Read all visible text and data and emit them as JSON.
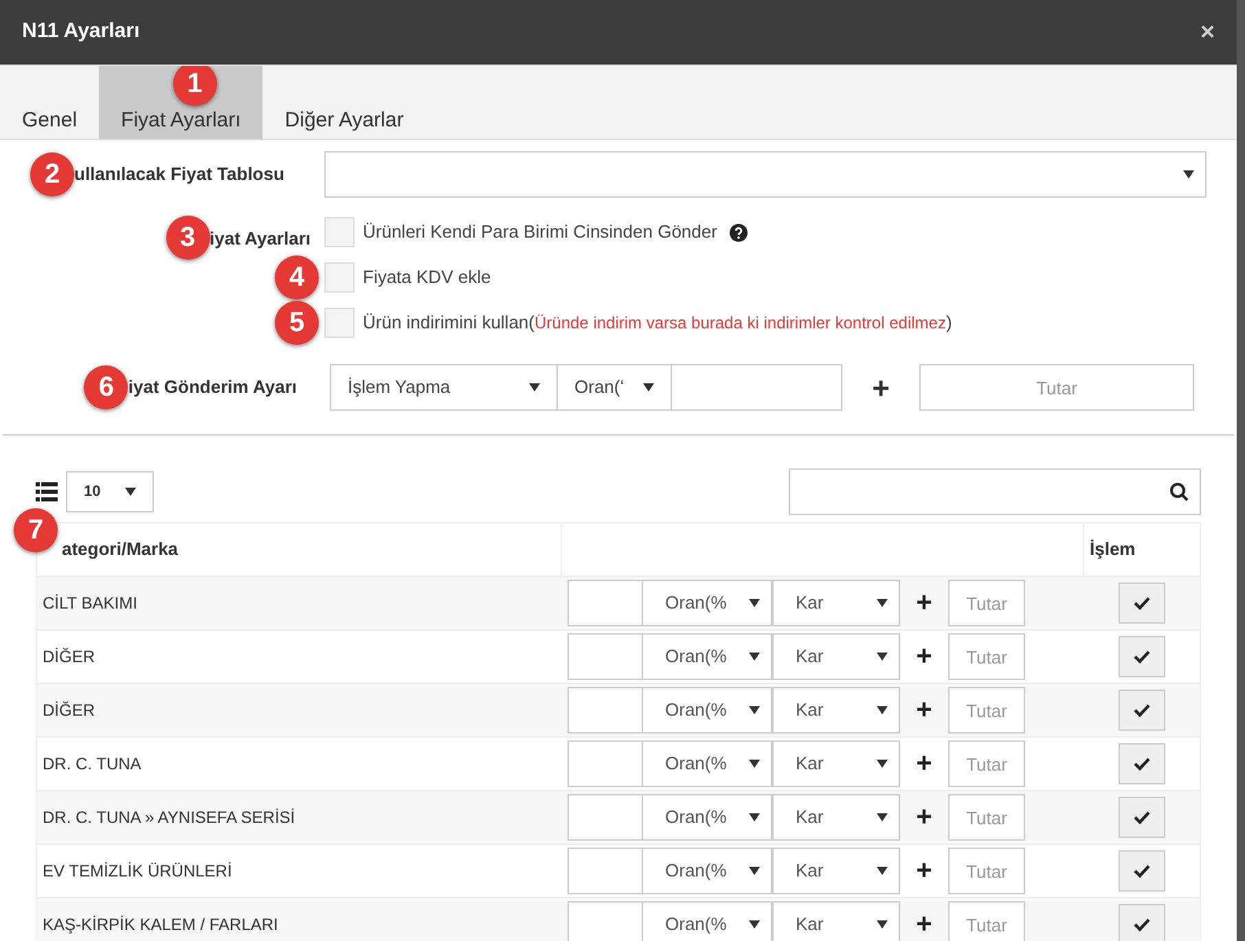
{
  "window": {
    "title": "N11 Ayarları",
    "close": "×"
  },
  "tabs": [
    {
      "label": "Genel",
      "selected": false
    },
    {
      "label": "Fiyat Ayarları",
      "selected": true,
      "badge": "1"
    },
    {
      "label": "Diğer Ayarlar",
      "selected": false
    }
  ],
  "price_table": {
    "badge": "2",
    "label": "ullanılacak Fiyat Tablosu"
  },
  "price_settings": {
    "badge": "3",
    "label": "iyat Ayarları",
    "options": [
      {
        "label": "Ürünleri Kendi Para Birimi Cinsinden Gönder",
        "checked": false,
        "help": true
      },
      {
        "badge": "4",
        "label": "Fiyata KDV ekle",
        "checked": false
      },
      {
        "badge": "5",
        "label": "Ürün indirimini kullan",
        "paren_open": "(",
        "note": "Üründe indirim varsa burada ki indirimler kontrol edilmez",
        "paren_close": ")",
        "checked": false
      }
    ]
  },
  "send_setting": {
    "badge": "6",
    "label": "iyat Gönderim Ayarı",
    "action": "İşlem Yapma",
    "rate": "Oran(ʻ",
    "plus": "+",
    "amount_placeholder": "Tutar"
  },
  "table_toolbar": {
    "page_size": "10"
  },
  "table": {
    "badge": "7",
    "columns": [
      "ategori/Marka",
      "İşlem"
    ],
    "rows": [
      {
        "name": "CİLT BAKIMI",
        "rate": "Oran(%",
        "type": "Kar",
        "plus": "+",
        "amount_placeholder": "Tutar"
      },
      {
        "name": "DİĞER",
        "rate": "Oran(%",
        "type": "Kar",
        "plus": "+",
        "amount_placeholder": "Tutar"
      },
      {
        "name": "DİĞER",
        "rate": "Oran(%",
        "type": "Kar",
        "plus": "+",
        "amount_placeholder": "Tutar"
      },
      {
        "name": "DR. C. TUNA",
        "rate": "Oran(%",
        "type": "Kar",
        "plus": "+",
        "amount_placeholder": "Tutar"
      },
      {
        "name": "DR. C. TUNA » AYNISEFA SERİSİ",
        "rate": "Oran(%",
        "type": "Kar",
        "plus": "+",
        "amount_placeholder": "Tutar"
      },
      {
        "name": "EV TEMİZLİK ÜRÜNLERİ",
        "rate": "Oran(%",
        "type": "Kar",
        "plus": "+",
        "amount_placeholder": "Tutar"
      },
      {
        "name": "KAŞ-KİRPİK KALEM / FARLARI",
        "rate": "Oran(%",
        "type": "Kar",
        "plus": "+",
        "amount_placeholder": "Tutar"
      }
    ]
  }
}
